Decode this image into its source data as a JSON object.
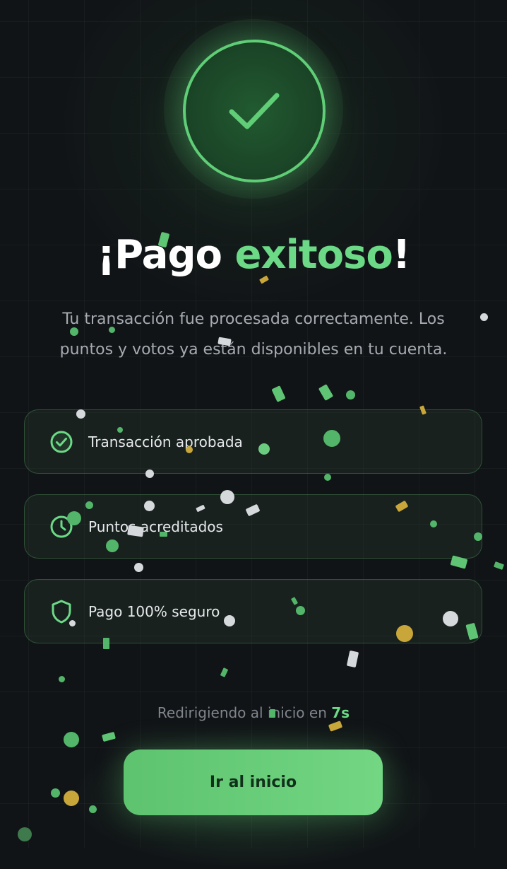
{
  "headline": {
    "prefix": "¡Pago ",
    "accent": "exitoso",
    "suffix": "!"
  },
  "subtitle": "Tu transacción fue procesada correctamente. Los puntos y votos ya están disponibles en tu cuenta.",
  "status_cards": [
    {
      "label": "Transacción aprobada",
      "icon": "check-circle-icon"
    },
    {
      "label": "Puntos acreditados",
      "icon": "clock-icon"
    },
    {
      "label": "Pago 100% seguro",
      "icon": "shield-icon"
    }
  ],
  "redirect": {
    "text": "Redirigiendo al inicio en ",
    "countdown": "7s"
  },
  "cta": {
    "label": "Ir al inicio"
  },
  "colors": {
    "background": "#111417",
    "accent_green": "#6cd987",
    "button_green": "#66cc79",
    "gold_confetti": "#c9a63a"
  }
}
